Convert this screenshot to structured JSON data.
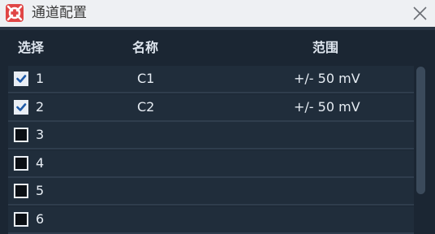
{
  "window": {
    "title": "通道配置",
    "icon": "app-logo-icon",
    "close_icon": "close-icon",
    "colors": {
      "titlebar_bg": "#eef0f3",
      "body_bg": "#1b2633",
      "row_bg": "#202d3b",
      "logo_red": "#e04545"
    }
  },
  "table": {
    "headers": {
      "select": "选择",
      "name": "名称",
      "range": "范围"
    },
    "rows": [
      {
        "checked": true,
        "number": "1",
        "name": "C1",
        "range": "+/- 50 mV"
      },
      {
        "checked": true,
        "number": "2",
        "name": "C2",
        "range": "+/- 50 mV"
      },
      {
        "checked": false,
        "number": "3",
        "name": "",
        "range": ""
      },
      {
        "checked": false,
        "number": "4",
        "name": "",
        "range": ""
      },
      {
        "checked": false,
        "number": "5",
        "name": "",
        "range": ""
      },
      {
        "checked": false,
        "number": "6",
        "name": "",
        "range": ""
      }
    ]
  }
}
